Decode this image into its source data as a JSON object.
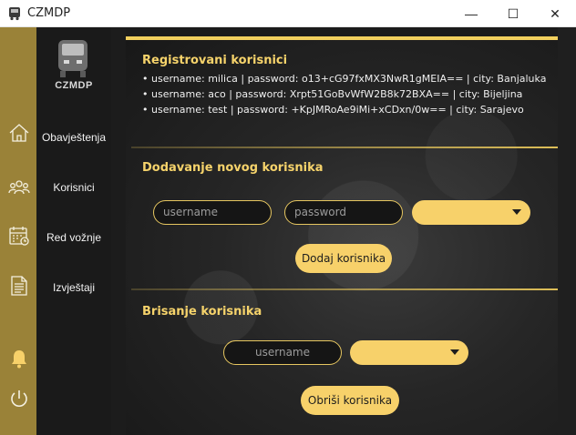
{
  "window": {
    "title": "CZMDP",
    "minimize": "—",
    "maximize": "☐",
    "close": "✕"
  },
  "logo": {
    "text": "CZMDP"
  },
  "sidebar": {
    "items": [
      {
        "label": "Obavještenja",
        "icon": "home-icon"
      },
      {
        "label": "Korisnici",
        "icon": "users-icon"
      },
      {
        "label": "Red vožnje",
        "icon": "calendar-icon"
      },
      {
        "label": "Izvještaji",
        "icon": "document-icon"
      }
    ],
    "bell_icon": "bell-icon",
    "power_icon": "power-icon"
  },
  "registered": {
    "title": "Registrovani korisnici",
    "users": [
      "username:  milica  | password:  o13+cG97fxMX3NwR1gMEIA==  | city:  Banjaluka",
      "username:  aco  | password:  Xrpt51GoBvWfW2B8k72BXA==  | city:  Bijeljina",
      "username:  test  | password:  +KpJMRoAe9iMi+xCDxn/0w==  | city:  Sarajevo"
    ]
  },
  "add_user": {
    "title": "Dodavanje novog korisnika",
    "username_placeholder": "username",
    "password_placeholder": "password",
    "city_value": "",
    "button": "Dodaj korisnika"
  },
  "delete_user": {
    "title": "Brisanje korisnika",
    "username_placeholder": "username",
    "combo_value": "",
    "button": "Obriši korisnika"
  },
  "colors": {
    "accent": "#f7d16a",
    "sidebar": "#9a8238",
    "panel": "#1a1a1a"
  }
}
